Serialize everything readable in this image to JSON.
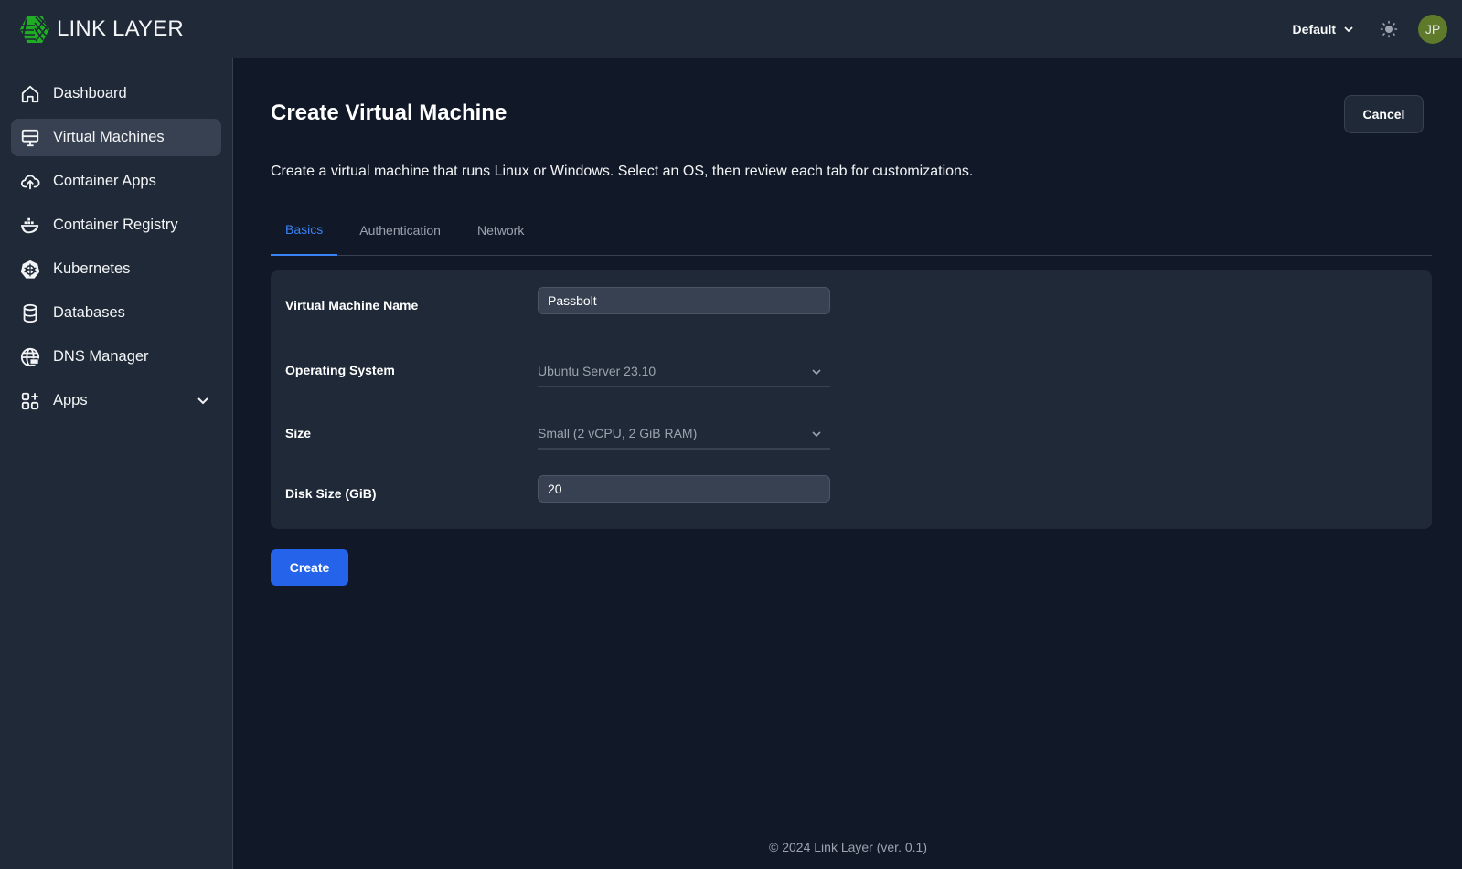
{
  "header": {
    "brand_name": "LINK LAYER",
    "project_selector": "Default",
    "theme_toggle_icon": "sun-icon",
    "avatar_initials": "JP",
    "avatar_color": "#5e7a2a"
  },
  "sidebar": {
    "items": [
      {
        "label": "Dashboard",
        "icon": "home-icon",
        "active": false
      },
      {
        "label": "Virtual Machines",
        "icon": "monitor-icon",
        "active": true
      },
      {
        "label": "Container Apps",
        "icon": "cloud-upload-icon",
        "active": false
      },
      {
        "label": "Container Registry",
        "icon": "docker-icon",
        "active": false
      },
      {
        "label": "Kubernetes",
        "icon": "kubernetes-icon",
        "active": false
      },
      {
        "label": "Databases",
        "icon": "database-icon",
        "active": false
      },
      {
        "label": "DNS Manager",
        "icon": "globe-icon",
        "active": false
      },
      {
        "label": "Apps",
        "icon": "apps-grid-icon",
        "active": false,
        "expandable": true
      }
    ]
  },
  "main": {
    "title": "Create Virtual Machine",
    "cancel_label": "Cancel",
    "description": "Create a virtual machine that runs Linux or Windows. Select an OS, then review each tab for customizations.",
    "tabs": [
      {
        "label": "Basics",
        "active": true
      },
      {
        "label": "Authentication",
        "active": false
      },
      {
        "label": "Network",
        "active": false
      }
    ],
    "form": {
      "vm_name": {
        "label": "Virtual Machine Name",
        "value": "Passbolt"
      },
      "os": {
        "label": "Operating System",
        "value": "Ubuntu Server 23.10"
      },
      "size": {
        "label": "Size",
        "value": "Small (2 vCPU, 2 GiB RAM)"
      },
      "disk": {
        "label": "Disk Size (GiB)",
        "value": "20"
      }
    },
    "create_label": "Create"
  },
  "footer": {
    "text": "© 2024 Link Layer (ver. 0.1)"
  },
  "colors": {
    "accent": "#2563eb",
    "tab_active": "#3b82f6",
    "brand_green": "#22c55e"
  }
}
